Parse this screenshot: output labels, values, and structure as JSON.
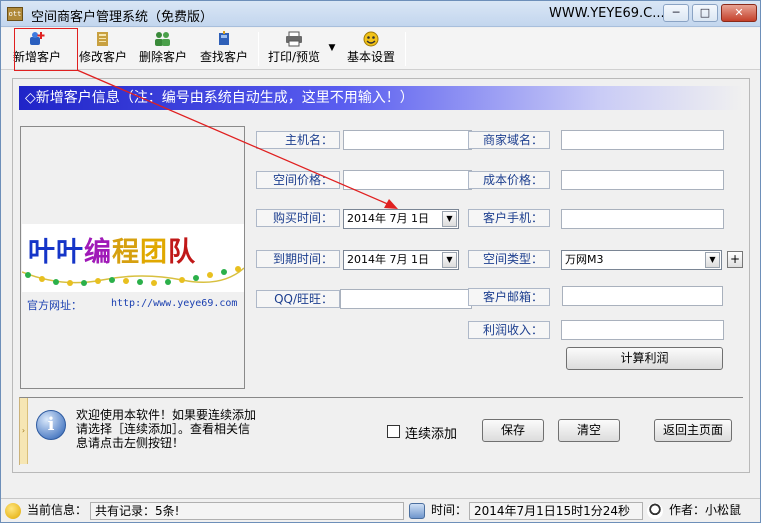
{
  "window": {
    "title": "空间商客户管理系统（免费版）",
    "title_right": "WWW.YEYE69.C...",
    "app_icon_text": "ott",
    "controls": {
      "minimize": "─",
      "maximize": "□",
      "close": "✕"
    }
  },
  "toolbar": {
    "items": [
      {
        "label": "新增客户",
        "icon": "add-user-icon"
      },
      {
        "label": "修改客户",
        "icon": "edit-user-icon"
      },
      {
        "label": "删除客户",
        "icon": "delete-user-icon"
      },
      {
        "label": "查找客户",
        "icon": "find-user-icon"
      },
      {
        "label": "打印/预览",
        "icon": "print-icon"
      },
      {
        "label": "基本设置",
        "icon": "settings-icon"
      }
    ],
    "dropdown_glyph": "▼"
  },
  "banner": {
    "text": "◇新增客户信息（注：编号由系统自动生成，这里不用输入！）"
  },
  "logo": {
    "chars": [
      "叶",
      "叶",
      "编",
      "程",
      "团",
      "队"
    ],
    "colors": [
      "#1535c8",
      "#1535c8",
      "#a01ab8",
      "#d6a010",
      "#e0a800",
      "#c01818"
    ],
    "site_label": "官方网址：",
    "site_url": "http://www.yeye69.com"
  },
  "form": {
    "host_label": "主机名：",
    "host_value": "",
    "merchant_domain_label": "商家域名：",
    "merchant_domain_value": "",
    "space_price_label": "空间价格：",
    "space_price_value": "",
    "cost_price_label": "成本价格：",
    "cost_price_value": "",
    "buy_time_label": "购买时间：",
    "buy_time_value": "2014年  7月  1日",
    "customer_phone_label": "客户手机：",
    "customer_phone_value": "",
    "expire_time_label": "到期时间：",
    "expire_time_value": "2014年  7月  1日",
    "space_type_label": "空间类型：",
    "space_type_value": "万网M3",
    "qq_label": "QQ/旺旺：",
    "qq_value": "",
    "customer_email_label": "客户邮箱：",
    "customer_email_value": "",
    "profit_label": "利润收入：",
    "profit_value": "",
    "calc_profit_button": "计算利润",
    "plus_button": "+"
  },
  "message": {
    "text": "欢迎使用本软件！如果要连续添加请选择［连续添加］。查看相关信息请点击左侧按钮！",
    "continuous_add_label": "连续添加",
    "continuous_add_checked": false,
    "save_button": "保存",
    "clear_button": "清空",
    "back_button": "返回主页面"
  },
  "statusbar": {
    "current_info_label": "当前信息：",
    "records_text": "共有记录：5条!",
    "time_label": "时间：",
    "time_value": "2014年7月1日15时1分24秒",
    "author_text": "作者：小松鼠"
  },
  "colors": {
    "banner_start": "#1f24c8",
    "annotation_red": "#e02020",
    "field_label_text": "#1d3f8f"
  }
}
